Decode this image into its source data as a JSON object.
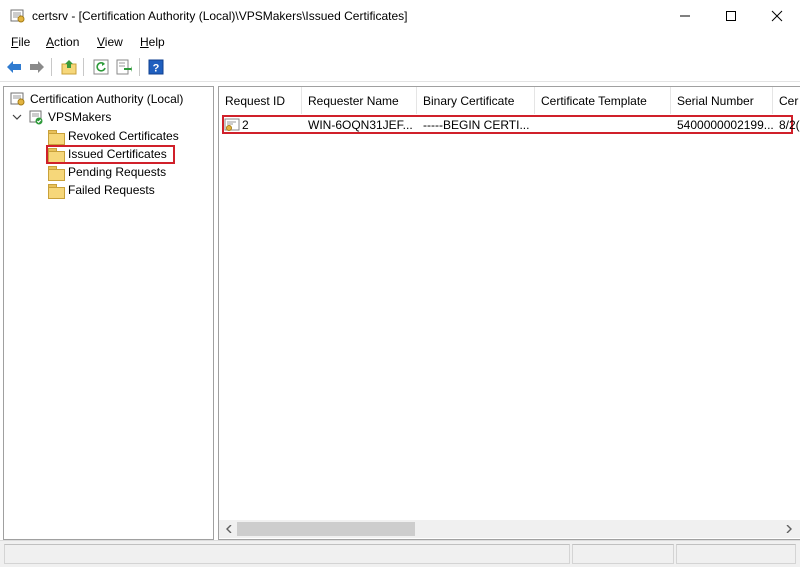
{
  "window": {
    "title": "certsrv - [Certification Authority (Local)\\VPSMakers\\Issued Certificates]",
    "minimize_glyph": "—",
    "maximize_glyph": "☐",
    "close_glyph": "✕"
  },
  "menu": {
    "items": [
      {
        "key": "F",
        "rest": "ile"
      },
      {
        "key": "A",
        "rest": "ction"
      },
      {
        "key": "V",
        "rest": "iew"
      },
      {
        "key": "H",
        "rest": "elp"
      }
    ]
  },
  "toolbar": {
    "icons": [
      "back-arrow-icon",
      "forward-arrow-icon",
      "up-folder-icon",
      "refresh-icon",
      "export-list-icon",
      "help-icon"
    ]
  },
  "tree": {
    "root": "Certification Authority (Local)",
    "ca_name": "VPSMakers",
    "folders": [
      "Revoked Certificates",
      "Issued Certificates",
      "Pending Requests",
      "Failed Requests"
    ],
    "selected": "Issued Certificates"
  },
  "list": {
    "columns": [
      "Request ID",
      "Requester Name",
      "Binary Certificate",
      "Certificate Template",
      "Serial Number",
      "Cer"
    ],
    "rows": [
      {
        "request_id": "2",
        "requester_name": "WIN-6OQN31JEF...",
        "binary_certificate": "-----BEGIN CERTI...",
        "certificate_template": "",
        "serial_number": "5400000002199...",
        "cert_date": "8/2("
      }
    ]
  },
  "colors": {
    "highlight": "#d0202a",
    "folder": "#f6d77a",
    "toolbar_blue": "#2f7bd0",
    "help_blue": "#1f5fbf"
  }
}
